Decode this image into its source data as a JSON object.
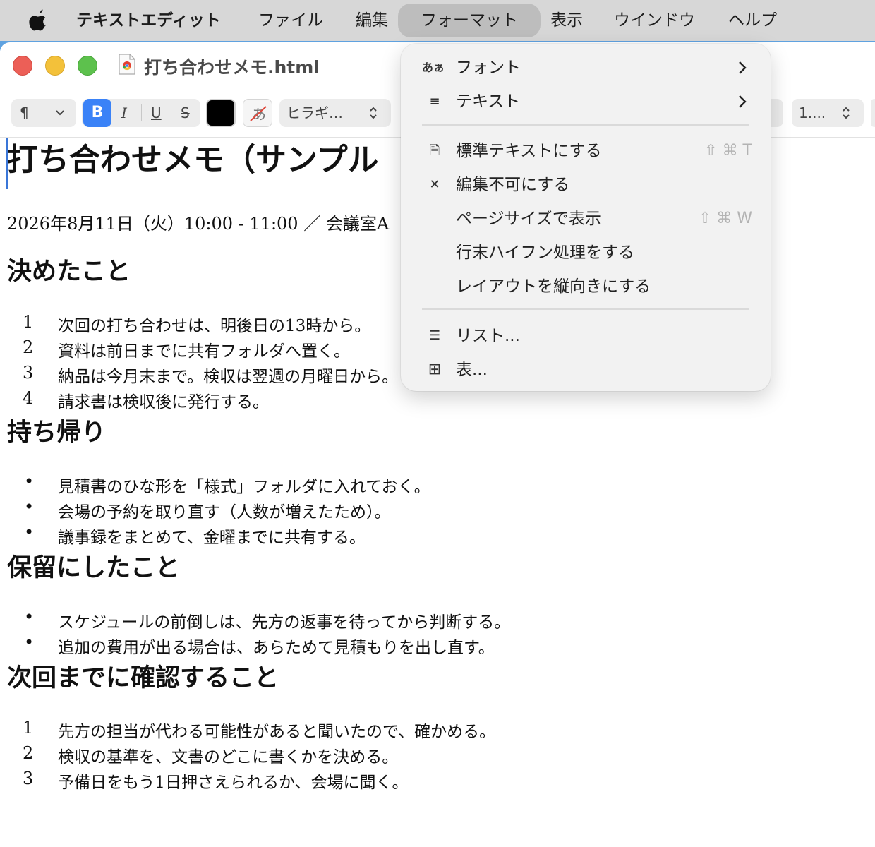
{
  "menubar": {
    "apple_icon": "apple-logo-icon",
    "app_name": "テキストエディット",
    "items": [
      "ファイル",
      "編集",
      "フォーマット",
      "表示",
      "ウインドウ",
      "ヘルプ"
    ],
    "active_item": "フォーマット"
  },
  "window": {
    "title": "打ち合わせメモ.html",
    "doc_icon": "chrome-html-document-icon"
  },
  "toolbar": {
    "paragraph_symbol": "¶",
    "bold_label": "B",
    "italic_label": "I",
    "underline_label": "U",
    "strike_label": "S",
    "text_color": "#000000",
    "font_name": "ヒラギ…",
    "font_size": "1...."
  },
  "format_menu": {
    "items": [
      {
        "icon": "あぁ",
        "icon_name": "font-icon",
        "label": "フォント",
        "submenu": true
      },
      {
        "icon": "≡",
        "icon_name": "text-align-icon",
        "label": "テキスト",
        "submenu": true
      },
      {
        "icon": "🗎",
        "icon_name": "document-icon",
        "label": "標準テキストにする",
        "shortcut": "⇧ ⌘ T"
      },
      {
        "icon": "✕",
        "icon_name": "lock-edit-icon",
        "label": "編集不可にする"
      },
      {
        "icon": "",
        "label": "ページサイズで表示",
        "shortcut": "⇧ ⌘ W"
      },
      {
        "icon": "",
        "label": "行末ハイフン処理をする"
      },
      {
        "icon": "",
        "label": "レイアウトを縦向きにする"
      },
      {
        "icon": "☰",
        "icon_name": "list-icon",
        "label": "リスト..."
      },
      {
        "icon": "⊞",
        "icon_name": "table-icon",
        "label": "表..."
      }
    ]
  },
  "document": {
    "title": "打ち合わせメモ（サンプル",
    "meta": "2026年8月11日（火）10:00 - 11:00 ／ 会議室A",
    "sections": [
      {
        "heading": "決めたこと",
        "list_type": "numbered",
        "items": [
          "次回の打ち合わせは、明後日の13時から。",
          "資料は前日までに共有フォルダへ置く。",
          "納品は今月末まで。検収は翌週の月曜日から。",
          "請求書は検収後に発行する。"
        ]
      },
      {
        "heading": "持ち帰り",
        "list_type": "bullet",
        "items": [
          "見積書のひな形を「様式」フォルダに入れておく。",
          "会場の予約を取り直す（人数が増えたため）。",
          "議事録をまとめて、金曜までに共有する。"
        ]
      },
      {
        "heading": "保留にしたこと",
        "list_type": "bullet",
        "items": [
          "スケジュールの前倒しは、先方の返事を待ってから判断する。",
          "追加の費用が出る場合は、あらためて見積もりを出し直す。"
        ]
      },
      {
        "heading": "次回までに確認すること",
        "list_type": "numbered",
        "items": [
          "先方の担当が代わる可能性があると聞いたので、確かめる。",
          "検収の基準を、文書のどこに書くかを決める。",
          "予備日をもう1日押さえられるか、会場に聞く。"
        ]
      }
    ]
  }
}
